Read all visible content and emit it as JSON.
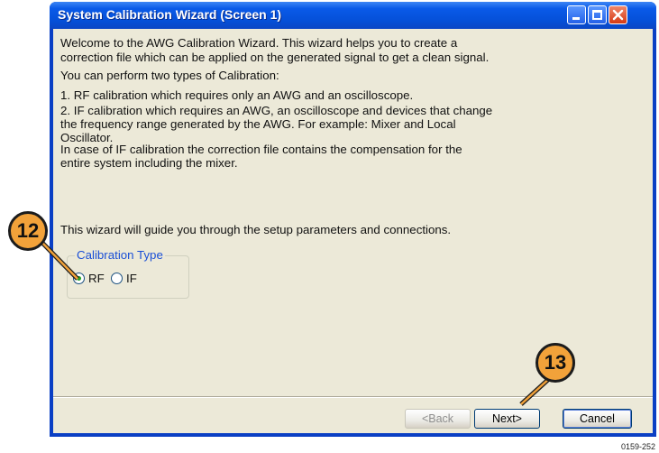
{
  "window": {
    "title": "System Calibration Wizard (Screen 1)"
  },
  "content": {
    "lines": [
      "Welcome to the AWG Calibration Wizard. This wizard helps you to create a",
      "correction file which can be applied on the generated signal to get a clean signal.",
      "You can perform two types of Calibration:",
      "1. RF calibration which requires only an AWG and an oscilloscope.",
      "2. IF calibration which requires an AWG,  an oscilloscope and devices that change",
      "the frequency range generated by the AWG. For example: Mixer and Local",
      "Oscillator.",
      "In case of IF calibration the correction file contains the compensation for the",
      "entire system including the mixer.",
      "This wizard will guide you through the setup parameters and connections."
    ]
  },
  "calibration_type": {
    "label": "Calibration Type",
    "options": [
      {
        "label": "RF",
        "selected": true
      },
      {
        "label": "IF",
        "selected": false
      }
    ]
  },
  "buttons": {
    "back": "<Back",
    "next": "Next>",
    "cancel": "Cancel"
  },
  "callouts": [
    "12",
    "13"
  ],
  "figure_code": "0159-252",
  "colors": {
    "titlebar": "#0550d8",
    "client_bg": "#ece9d8",
    "callout": "#f2a23a",
    "group_label": "#1a4fd6"
  }
}
